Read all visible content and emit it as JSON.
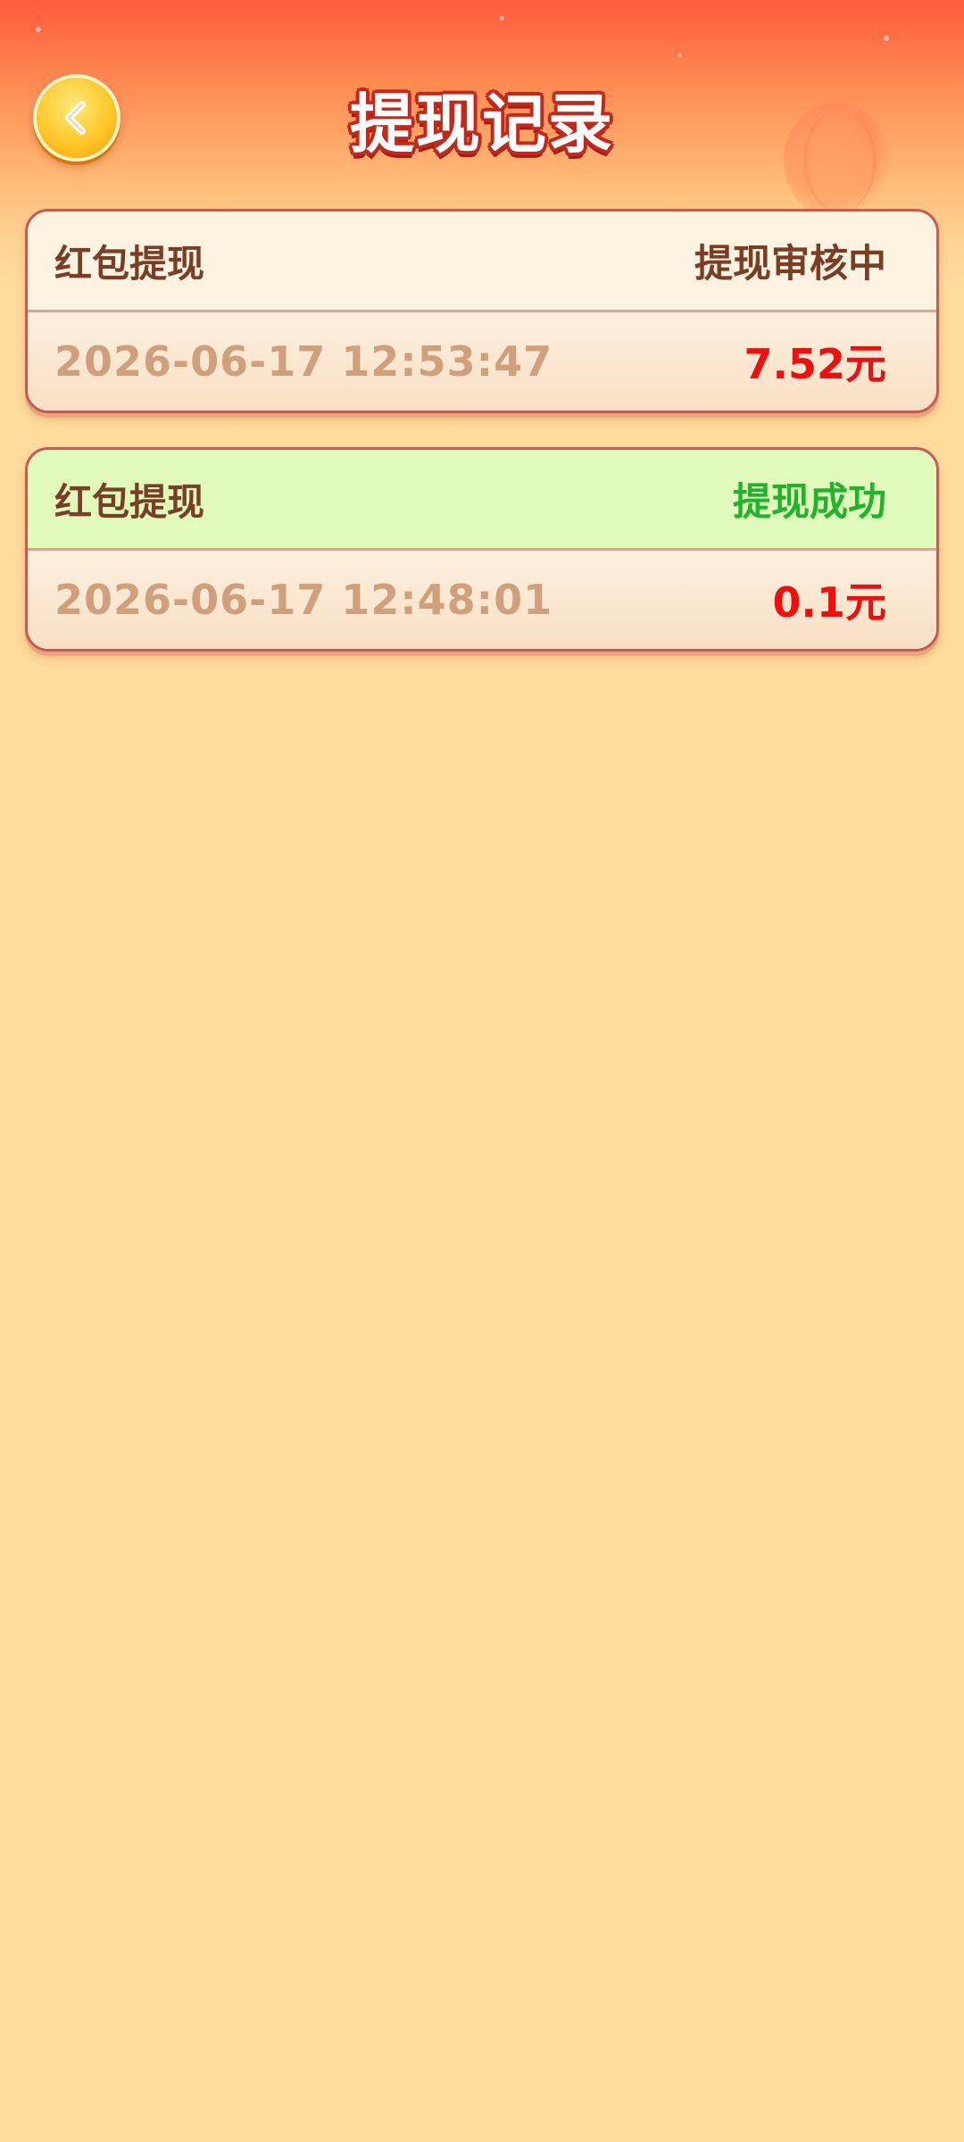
{
  "header": {
    "title": "提现记录",
    "back_icon": "chevron-left-icon"
  },
  "colors": {
    "pending_status": "#7A3D25",
    "success_status": "#22B22C",
    "amount": "#F20E0E"
  },
  "records": [
    {
      "type": "红包提现",
      "status": "提现审核中",
      "status_kind": "pending",
      "time": "2026-06-17 12:53:47",
      "amount": "7.52元"
    },
    {
      "type": "红包提现",
      "status": "提现成功",
      "status_kind": "success",
      "time": "2026-06-17 12:48:01",
      "amount": "0.1元"
    }
  ]
}
